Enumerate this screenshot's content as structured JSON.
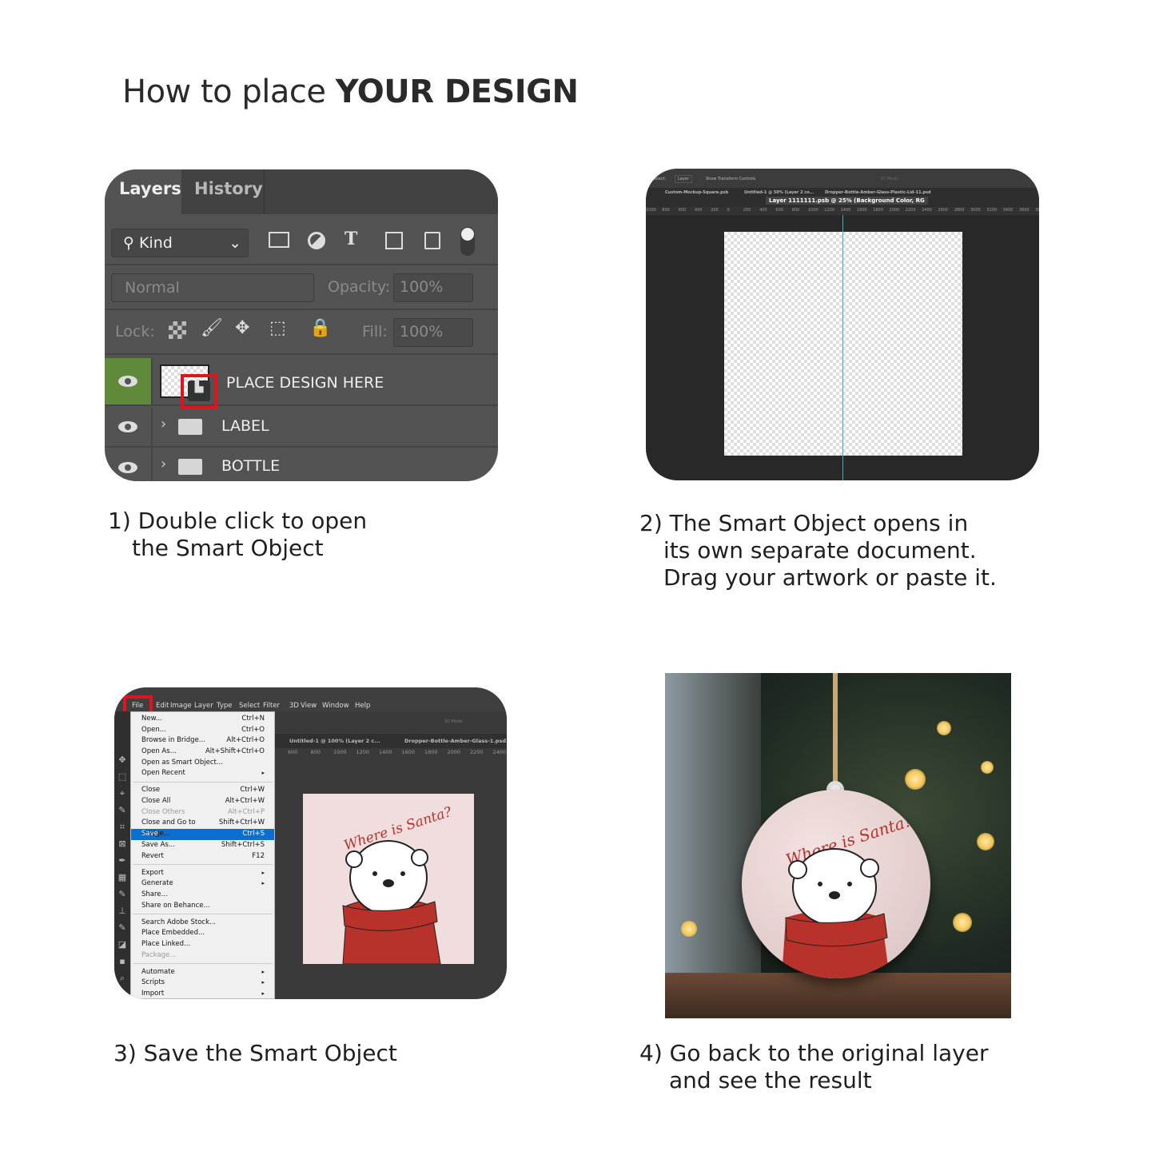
{
  "title": {
    "prefix": "How to place ",
    "emphasis": "YOUR DESIGN"
  },
  "steps": [
    {
      "line1": "1) Double click to open",
      "line2": "the Smart Object"
    },
    {
      "line1": "2) The Smart Object opens in",
      "line2": "its own separate document.",
      "line3": "Drag your artwork or paste it."
    },
    {
      "line1": "3) Save the Smart Object"
    },
    {
      "line1": "4) Go back to the original layer",
      "line2": "and see the result"
    }
  ],
  "layers_panel": {
    "tabs": [
      "Layers",
      "History"
    ],
    "filter_kind": "Kind",
    "blend_mode": "Normal",
    "opacity_label": "Opacity:",
    "opacity_value": "100%",
    "lock_label": "Lock:",
    "fill_label": "Fill:",
    "fill_value": "100%",
    "layers": [
      {
        "name": "PLACE DESIGN HERE",
        "type": "smart-object",
        "selected": true
      },
      {
        "name": "LABEL",
        "type": "group"
      },
      {
        "name": "BOTTLE",
        "type": "group"
      }
    ],
    "accent_color": "#5e8a3a",
    "highlight_color": "#e0141e"
  },
  "smart_object_doc": {
    "options": {
      "select_label": "Select:",
      "select_value": "Layer",
      "transform_label": "Show Transform Controls",
      "mode_label": "3D Mode:"
    },
    "tabs": [
      "Custom-Mockup-Square.psb",
      "Untitled-1 @ 50% (Layer 2 co...",
      "Dropper-Bottle-Amber-Glass-Plastic-Lid-11.psd",
      "Layer 1111111.psb @ 25% (Background Color, RG"
    ],
    "ruler": [
      "1000",
      "800",
      "600",
      "400",
      "200",
      "0",
      "200",
      "400",
      "600",
      "800",
      "1000",
      "1200",
      "1400",
      "1600",
      "1800",
      "2000",
      "2200",
      "2400",
      "2600",
      "2800",
      "3000",
      "3200",
      "3400",
      "3600",
      "3800"
    ]
  },
  "save_screen": {
    "menubar": [
      "File",
      "Edit",
      "Image",
      "Layer",
      "Type",
      "Select",
      "Filter",
      "3D",
      "View",
      "Window",
      "Help"
    ],
    "tabs": [
      "Untitled-1 @ 100% (Layer 2 c...",
      "Dropper-Bottle-Amber-Glass-1.psd"
    ],
    "mode_label": "3D Mode:",
    "ruler": [
      "600",
      "800",
      "1000",
      "1200",
      "1400",
      "1600",
      "1800",
      "2000",
      "2200",
      "2400"
    ],
    "file_menu": [
      [
        {
          "label": "New...",
          "shortcut": "Ctrl+N"
        },
        {
          "label": "Open...",
          "shortcut": "Ctrl+O"
        },
        {
          "label": "Browse in Bridge...",
          "shortcut": "Alt+Ctrl+O"
        },
        {
          "label": "Open As...",
          "shortcut": "Alt+Shift+Ctrl+O"
        },
        {
          "label": "Open as Smart Object...",
          "shortcut": ""
        },
        {
          "label": "Open Recent",
          "shortcut": "",
          "submenu": true
        }
      ],
      [
        {
          "label": "Close",
          "shortcut": "Ctrl+W"
        },
        {
          "label": "Close All",
          "shortcut": "Alt+Ctrl+W"
        },
        {
          "label": "Close Others",
          "shortcut": "Alt+Ctrl+P",
          "disabled": true
        },
        {
          "label": "Close and Go to Bridge...",
          "shortcut": "Shift+Ctrl+W"
        },
        {
          "label": "Save",
          "shortcut": "Ctrl+S",
          "selected": true
        },
        {
          "label": "Save As...",
          "shortcut": "Shift+Ctrl+S"
        },
        {
          "label": "Revert",
          "shortcut": "F12"
        }
      ],
      [
        {
          "label": "Export",
          "shortcut": "",
          "submenu": true
        },
        {
          "label": "Generate",
          "shortcut": "",
          "submenu": true
        },
        {
          "label": "Share...",
          "shortcut": ""
        },
        {
          "label": "Share on Behance...",
          "shortcut": ""
        }
      ],
      [
        {
          "label": "Search Adobe Stock...",
          "shortcut": ""
        },
        {
          "label": "Place Embedded...",
          "shortcut": ""
        },
        {
          "label": "Place Linked...",
          "shortcut": ""
        },
        {
          "label": "Package...",
          "shortcut": "",
          "disabled": true
        }
      ],
      [
        {
          "label": "Automate",
          "shortcut": "",
          "submenu": true
        },
        {
          "label": "Scripts",
          "shortcut": "",
          "submenu": true
        },
        {
          "label": "Import",
          "shortcut": "",
          "submenu": true
        }
      ]
    ],
    "selection_color": "#0a6fd1"
  },
  "artwork": {
    "text": "Where is Santa?",
    "background": "#f0dede",
    "sweater_color": "#b8312b"
  }
}
